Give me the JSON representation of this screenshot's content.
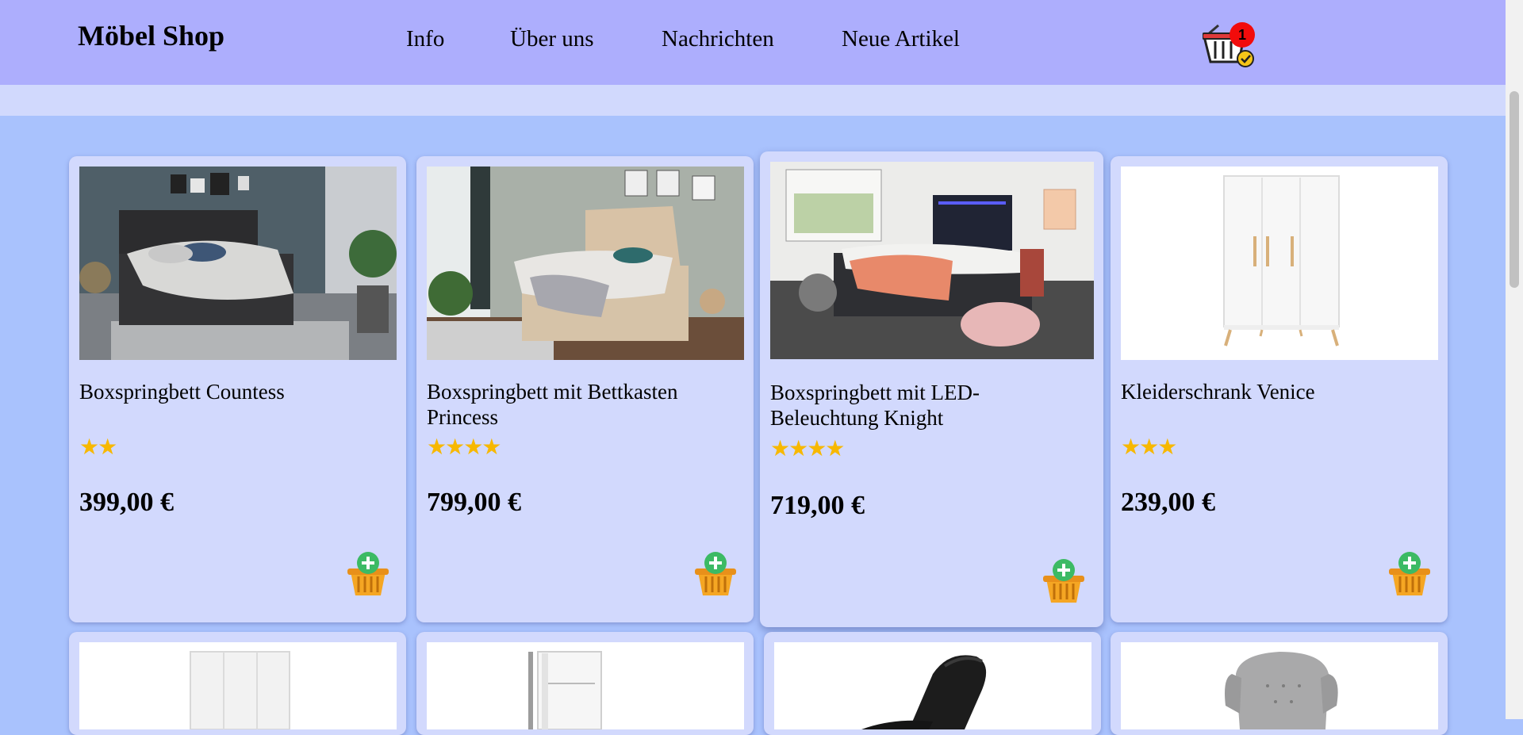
{
  "header": {
    "logo": "Möbel Shop",
    "nav": [
      "Info",
      "Über uns",
      "Nachrichten",
      "Neue Artikel"
    ],
    "cart_count": "1",
    "cart_icon": "shopping-basket-icon"
  },
  "products": [
    {
      "name": "Boxspringbett Countess",
      "rating": 2,
      "stars": "★★",
      "price": "399,00 €",
      "image": "dark-boxspring-bed-photo"
    },
    {
      "name": "Boxspringbett mit Bettkasten Princess",
      "rating": 4,
      "stars": "★★★★",
      "price": "799,00 €",
      "image": "beige-boxspring-bed-photo"
    },
    {
      "name": "Boxspringbett mit LED-Beleuchtung Knight",
      "rating": 4,
      "stars": "★★★★",
      "price": "719,00 €",
      "image": "led-boxspring-bed-photo"
    },
    {
      "name": "Kleiderschrank Venice",
      "rating": 3,
      "stars": "★★★",
      "price": "239,00 €",
      "image": "white-wardrobe-photo"
    }
  ],
  "colors": {
    "header_bg": "#adaefd",
    "page_bg": "#a9c2fd",
    "card_bg": "#d2d9fd",
    "star": "#f7b800",
    "badge": "#f20b0b"
  }
}
